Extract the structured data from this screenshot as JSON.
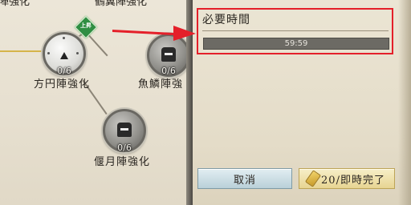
{
  "tree": {
    "top_left_label": "陣強化",
    "top_right_label": "鶴翼陣強化",
    "badge_text": "上昇",
    "nodes": [
      {
        "name": "方円陣強化",
        "count": "0/6"
      },
      {
        "name": "魚鱗陣強",
        "count": "0/6"
      },
      {
        "name": "偃月陣強化",
        "count": "0/6"
      }
    ]
  },
  "info": {
    "required_time_label": "必要時間",
    "timer_value": "59:59",
    "progress": 0.0
  },
  "buttons": {
    "cancel_label": "取消",
    "complete_label": "20/即時完了"
  },
  "colors": {
    "highlight": "#e4202a",
    "arrow": "#e4202a",
    "badge": "#2f8e42"
  }
}
